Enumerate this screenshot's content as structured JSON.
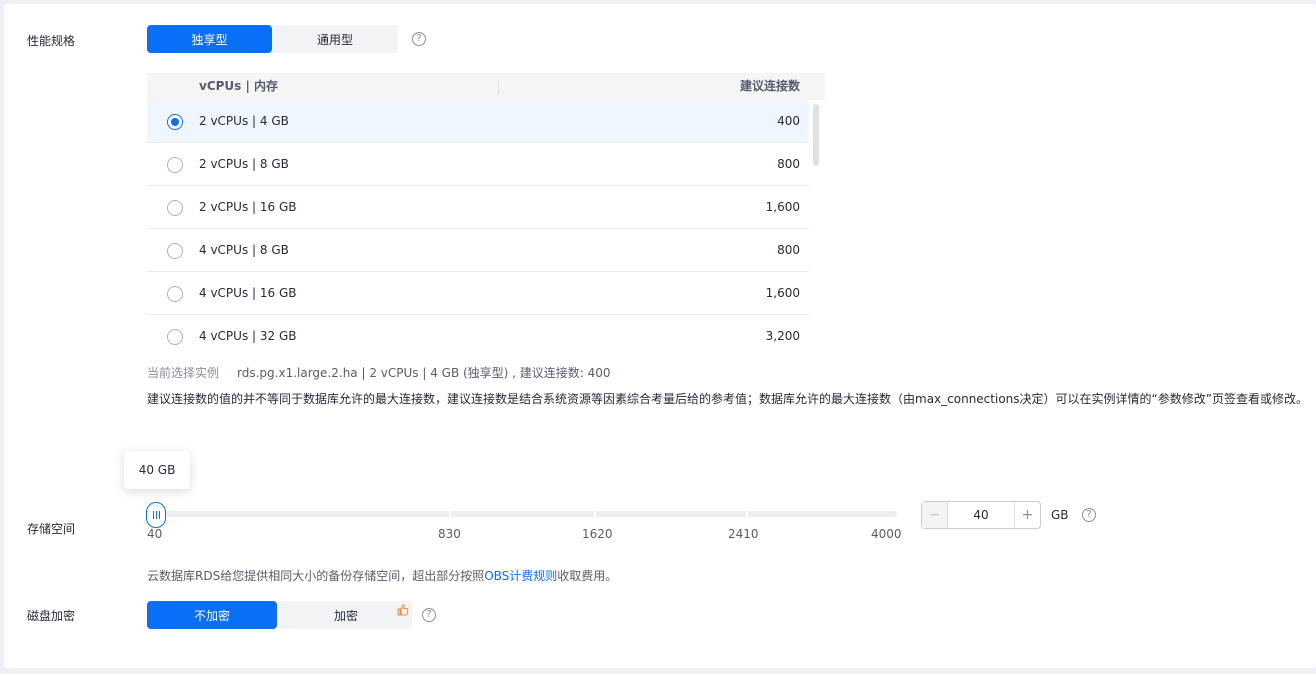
{
  "spec": {
    "label": "性能规格",
    "types": [
      "独享型",
      "通用型"
    ],
    "active_type": "独享型",
    "help_icon": "question-circle-icon"
  },
  "table": {
    "headers": {
      "spec": "vCPUs | 内存",
      "conn": "建议连接数"
    },
    "rows": [
      {
        "spec": "2 vCPUs | 4 GB",
        "conn": "400",
        "selected": true
      },
      {
        "spec": "2 vCPUs | 8 GB",
        "conn": "800",
        "selected": false
      },
      {
        "spec": "2 vCPUs | 16 GB",
        "conn": "1,600",
        "selected": false
      },
      {
        "spec": "4 vCPUs | 8 GB",
        "conn": "800",
        "selected": false
      },
      {
        "spec": "4 vCPUs | 16 GB",
        "conn": "1,600",
        "selected": false
      },
      {
        "spec": "4 vCPUs | 32 GB",
        "conn": "3,200",
        "selected": false
      }
    ]
  },
  "current": {
    "key": "当前选择实例",
    "value": "rds.pg.x1.large.2.ha | 2 vCPUs | 4 GB (独享型) , 建议连接数: 400"
  },
  "description": "建议连接数的值的并不等同于数据库允许的最大连接数，建议连接数是结合系统资源等因素综合考量后给的参考值；数据库允许的最大连接数（由max_connections决定）可以在实例详情的“参数修改”页签查看或修改。",
  "storage": {
    "label": "存储空间",
    "tooltip": "40 GB",
    "ticks": [
      "40",
      "830",
      "1620",
      "2410",
      "4000"
    ],
    "value": "40",
    "unit": "GB",
    "min": 40,
    "max": 4000,
    "minus": "−",
    "plus": "+",
    "note_prefix": "云数据库RDS给您提供相同大小的备份存储空间，超出部分按照",
    "note_link": "OBS计费规则",
    "note_suffix": "收取费用。"
  },
  "encryption": {
    "label": "磁盘加密",
    "options": [
      "不加密",
      "加密"
    ],
    "active": "不加密"
  },
  "colors": {
    "primary": "#0a6ff8",
    "border": "#dfe1e6"
  }
}
